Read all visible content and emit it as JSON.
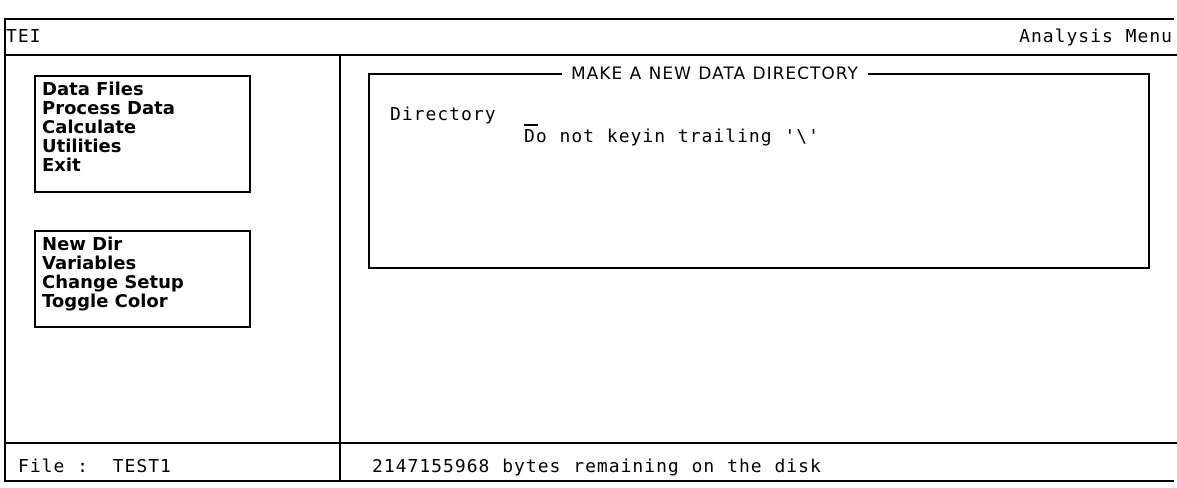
{
  "header": {
    "app_name": "TEI",
    "menu_title": "Analysis Menu"
  },
  "main_menu": {
    "items": [
      "Data Files",
      "Process Data",
      "Calculate",
      "Utilities",
      "Exit"
    ]
  },
  "utilities_menu": {
    "items": [
      "New Dir",
      "Variables",
      "Change Setup",
      "Toggle Color"
    ]
  },
  "dialog": {
    "title": "MAKE A NEW DATA DIRECTORY",
    "directory_label": "Directory",
    "directory_value": "",
    "hint": "Do not keyin trailing '\\'"
  },
  "status_bar": {
    "file": "File :  TEST1",
    "disk": "2147155968 bytes remaining on the disk"
  }
}
